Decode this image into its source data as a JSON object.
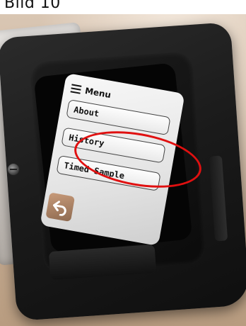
{
  "caption": "Bild 10",
  "screen": {
    "title": "Menu",
    "items": [
      {
        "label": "About"
      },
      {
        "label": "History"
      },
      {
        "label": "Timed Sample"
      }
    ],
    "highlighted_item": "History"
  },
  "icons": {
    "menu": "hamburger-icon",
    "back": "back-arrow-icon"
  },
  "colors": {
    "highlight": "#e01010",
    "housing": "#1a1a1a"
  }
}
